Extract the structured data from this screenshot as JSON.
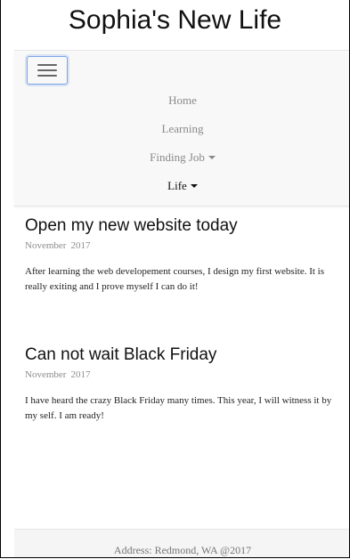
{
  "header": {
    "title": "Sophia's New Life"
  },
  "nav": {
    "items": [
      {
        "label": "Home"
      },
      {
        "label": "Learning"
      },
      {
        "label": "Finding Job"
      },
      {
        "label": "Life"
      }
    ]
  },
  "posts": [
    {
      "title": "Open my new website today",
      "date_month": "November",
      "date_year": "2017",
      "body": "After learning the web developement courses, I design my first website. It is really exiting and I prove myself I can do it!"
    },
    {
      "title": "Can not wait Black Friday",
      "date_month": "November",
      "date_year": "2017",
      "body": "I have heard the crazy Black Friday many times. This year, I will witness it by my self. I am ready!"
    }
  ],
  "footer": {
    "address": "Address: Redmond, WA @2017"
  },
  "colors": {
    "navbar_bg": "#f8f8f8",
    "toggler_border": "#7ea6e6",
    "nav_text": "#8a8a8a",
    "nav_active_text": "#111111",
    "meta_text": "#8d8d8d"
  },
  "icons": {
    "toggler": "hamburger-menu-icon",
    "dropdown": "caret-down-icon"
  }
}
